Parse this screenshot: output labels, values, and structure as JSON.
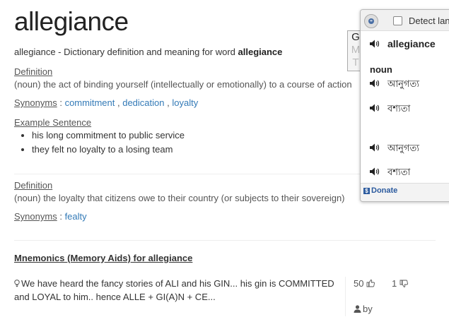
{
  "word": "allegiance",
  "subtitle": {
    "prefix": "allegiance - Dictionary definition and meaning for word ",
    "word": "allegiance"
  },
  "definitions": [
    {
      "label": "Definition",
      "text": "(noun) the act of binding yourself (intellectually or emotionally) to a course of action",
      "synonyms_label": "Synonyms",
      "synonyms": [
        "commitment",
        "dedication",
        "loyalty"
      ],
      "example_label": "Example Sentence",
      "examples": [
        "his long commitment to public service",
        "they felt no loyalty to a losing team"
      ]
    },
    {
      "label": "Definition",
      "text": "(noun) the loyalty that citizens owe to their country (or subjects to their sovereign)",
      "synonyms_label": "Synonyms",
      "synonyms": [
        "fealty"
      ]
    }
  ],
  "mnemonics": {
    "title": "Mnemonics (Memory Aids) for allegiance",
    "text": "We have heard the fancy stories of ALI and his GIN... his gin is COMMITTED and LOYAL to him.. hence ALLE + GI(A)N + CE...",
    "upvotes": "50",
    "downvotes": "1",
    "by_label": "by",
    "icons": [
      "lightbulb-icon",
      "thumbs-up-icon",
      "thumbs-down-icon",
      "user-icon"
    ]
  },
  "popup": {
    "tab_letters": [
      "G",
      "M",
      "T"
    ],
    "detect_label": "Detect lan",
    "word": "allegiance",
    "pos": "noun",
    "translations": [
      "আনুগত্য",
      "বশ্যতা",
      "আনুগত্য",
      "বশ্যতা"
    ],
    "donate_label": "Donate",
    "icons": [
      "globe-icon",
      "speaker-icon"
    ]
  },
  "colors": {
    "link": "#337ab7",
    "text": "#555555",
    "donate": "#2b5a9e"
  }
}
